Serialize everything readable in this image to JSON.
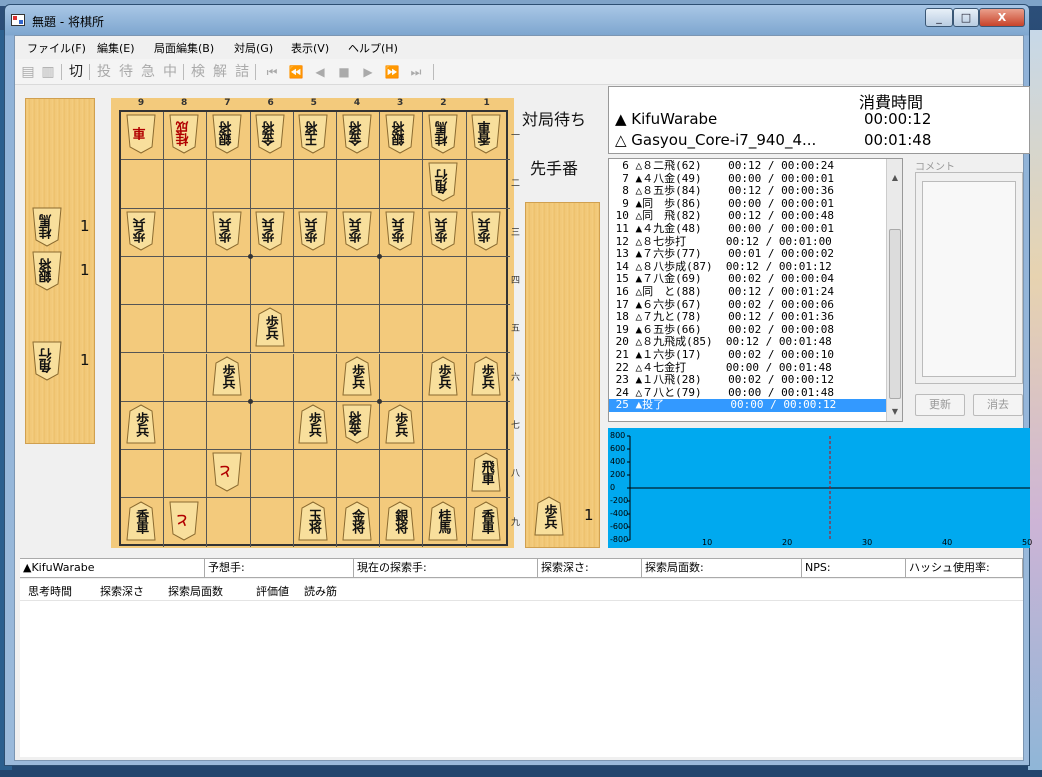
{
  "window": {
    "title": "無題 - 将棋所",
    "minimize": "_",
    "maximize": "□",
    "close": "X"
  },
  "menu": [
    "ファイル(F)",
    "編集(E)",
    "局面編集(B)",
    "対局(G)",
    "表示(V)",
    "ヘルプ(H)"
  ],
  "toolbar": {
    "buttons": [
      "切",
      "投",
      "待",
      "急",
      "中",
      "検",
      "解",
      "詰"
    ],
    "nav": [
      "⏮",
      "⏪",
      "◀",
      "■",
      "▶",
      "⏩",
      "⏭"
    ]
  },
  "board": {
    "col_numbers": [
      "9",
      "8",
      "7",
      "6",
      "5",
      "4",
      "3",
      "2",
      "1"
    ],
    "row_numbers": [
      "一",
      "二",
      "三",
      "四",
      "五",
      "六",
      "七",
      "八",
      "九"
    ],
    "pieces": [
      {
        "col": 9,
        "row": 1,
        "text": "車",
        "side": "gote",
        "red": true
      },
      {
        "col": 8,
        "row": 1,
        "text": "桂成",
        "side": "gote",
        "red": true
      },
      {
        "col": 7,
        "row": 1,
        "text": "銀将",
        "side": "gote"
      },
      {
        "col": 6,
        "row": 1,
        "text": "金将",
        "side": "gote"
      },
      {
        "col": 5,
        "row": 1,
        "text": "王将",
        "side": "gote"
      },
      {
        "col": 4,
        "row": 1,
        "text": "金将",
        "side": "gote"
      },
      {
        "col": 3,
        "row": 1,
        "text": "銀将",
        "side": "gote"
      },
      {
        "col": 2,
        "row": 1,
        "text": "桂馬",
        "side": "gote"
      },
      {
        "col": 1,
        "row": 1,
        "text": "香車",
        "side": "gote"
      },
      {
        "col": 2,
        "row": 2,
        "text": "角行",
        "side": "gote"
      },
      {
        "col": 9,
        "row": 3,
        "text": "歩兵",
        "side": "gote"
      },
      {
        "col": 7,
        "row": 3,
        "text": "歩兵",
        "side": "gote"
      },
      {
        "col": 6,
        "row": 3,
        "text": "歩兵",
        "side": "gote"
      },
      {
        "col": 5,
        "row": 3,
        "text": "歩兵",
        "side": "gote"
      },
      {
        "col": 4,
        "row": 3,
        "text": "歩兵",
        "side": "gote"
      },
      {
        "col": 3,
        "row": 3,
        "text": "歩兵",
        "side": "gote"
      },
      {
        "col": 2,
        "row": 3,
        "text": "歩兵",
        "side": "gote"
      },
      {
        "col": 1,
        "row": 3,
        "text": "歩兵",
        "side": "gote"
      },
      {
        "col": 6,
        "row": 5,
        "text": "歩兵",
        "side": "sente"
      },
      {
        "col": 7,
        "row": 6,
        "text": "歩兵",
        "side": "sente"
      },
      {
        "col": 4,
        "row": 6,
        "text": "歩兵",
        "side": "sente"
      },
      {
        "col": 2,
        "row": 6,
        "text": "歩兵",
        "side": "sente"
      },
      {
        "col": 1,
        "row": 6,
        "text": "歩兵",
        "side": "sente"
      },
      {
        "col": 9,
        "row": 7,
        "text": "歩兵",
        "side": "sente"
      },
      {
        "col": 5,
        "row": 7,
        "text": "歩兵",
        "side": "sente"
      },
      {
        "col": 4,
        "row": 7,
        "text": "金将",
        "side": "gote"
      },
      {
        "col": 3,
        "row": 7,
        "text": "歩兵",
        "side": "sente"
      },
      {
        "col": 7,
        "row": 8,
        "text": "と",
        "side": "gote",
        "red": true
      },
      {
        "col": 1,
        "row": 8,
        "text": "飛車",
        "side": "sente"
      },
      {
        "col": 9,
        "row": 9,
        "text": "香車",
        "side": "sente"
      },
      {
        "col": 8,
        "row": 9,
        "text": "と",
        "side": "gote",
        "red": true
      },
      {
        "col": 5,
        "row": 9,
        "text": "玉将",
        "side": "sente"
      },
      {
        "col": 4,
        "row": 9,
        "text": "金将",
        "side": "sente"
      },
      {
        "col": 3,
        "row": 9,
        "text": "銀将",
        "side": "sente"
      },
      {
        "col": 2,
        "row": 9,
        "text": "桂馬",
        "side": "sente"
      },
      {
        "col": 1,
        "row": 9,
        "text": "香車",
        "side": "sente"
      }
    ]
  },
  "gote_hand": [
    {
      "text": "桂馬",
      "count": "1"
    },
    {
      "text": "銀将",
      "count": "1"
    },
    {
      "text": "角行",
      "count": "1"
    }
  ],
  "sente_hand": [
    {
      "text": "歩兵",
      "count": "1"
    }
  ],
  "status": {
    "waiting": "対局待ち",
    "turn": "先手番"
  },
  "players": {
    "header": "消費時間",
    "sente_name": "▲ KifuWarabe",
    "sente_time": "00:00:12",
    "gote_name": "△ Gasyou_Core-i7_940_4...",
    "gote_time": "00:01:48"
  },
  "kifu": [
    "  6 △８二飛(62)    00:12 / 00:00:24",
    "  7 ▲４八金(49)    00:00 / 00:00:01",
    "  8 △８五歩(84)    00:12 / 00:00:36",
    "  9 ▲同　歩(86)    00:00 / 00:00:01",
    " 10 △同　飛(82)    00:12 / 00:00:48",
    " 11 ▲４九金(48)    00:00 / 00:00:01",
    " 12 △８七歩打      00:12 / 00:01:00",
    " 13 ▲７六歩(77)    00:01 / 00:00:02",
    " 14 △８八歩成(87)  00:12 / 00:01:12",
    " 15 ▲７八金(69)    00:02 / 00:00:04",
    " 16 △同　と(88)    00:12 / 00:01:24",
    " 17 ▲６六歩(67)    00:02 / 00:00:06",
    " 18 △７九と(78)    00:12 / 00:01:36",
    " 19 ▲６五歩(66)    00:02 / 00:00:08",
    " 20 △８九飛成(85)  00:12 / 00:01:48",
    " 21 ▲１六歩(17)    00:02 / 00:00:10",
    " 22 △４七金打      00:00 / 00:01:48",
    " 23 ▲１八飛(28)    00:02 / 00:00:12",
    " 24 △７八と(79)    00:00 / 00:01:48",
    " 25 ▲投了          00:00 / 00:00:12"
  ],
  "kifu_selected": 19,
  "comment": {
    "label": "コメント",
    "update": "更新",
    "clear": "消去"
  },
  "graph": {
    "y_labels": [
      "800",
      "600",
      "400",
      "200",
      "0",
      "-200",
      "-400",
      "-600",
      "-800"
    ],
    "x_labels": [
      "10",
      "20",
      "30",
      "40",
      "50"
    ],
    "current_move": 25,
    "x_max": 50,
    "y_max": 800,
    "colors": {
      "bg": "#00a9ef",
      "marker": "#cc0000"
    }
  },
  "statusbar": [
    "▲KifuWarabe",
    "予想手:",
    "現在の探索手:",
    "探索深さ:",
    "探索局面数:",
    "NPS:",
    "ハッシュ使用率:"
  ],
  "analysis_headers": [
    "思考時間",
    "探索深さ",
    "探索局面数",
    "評価値",
    "読み筋"
  ]
}
